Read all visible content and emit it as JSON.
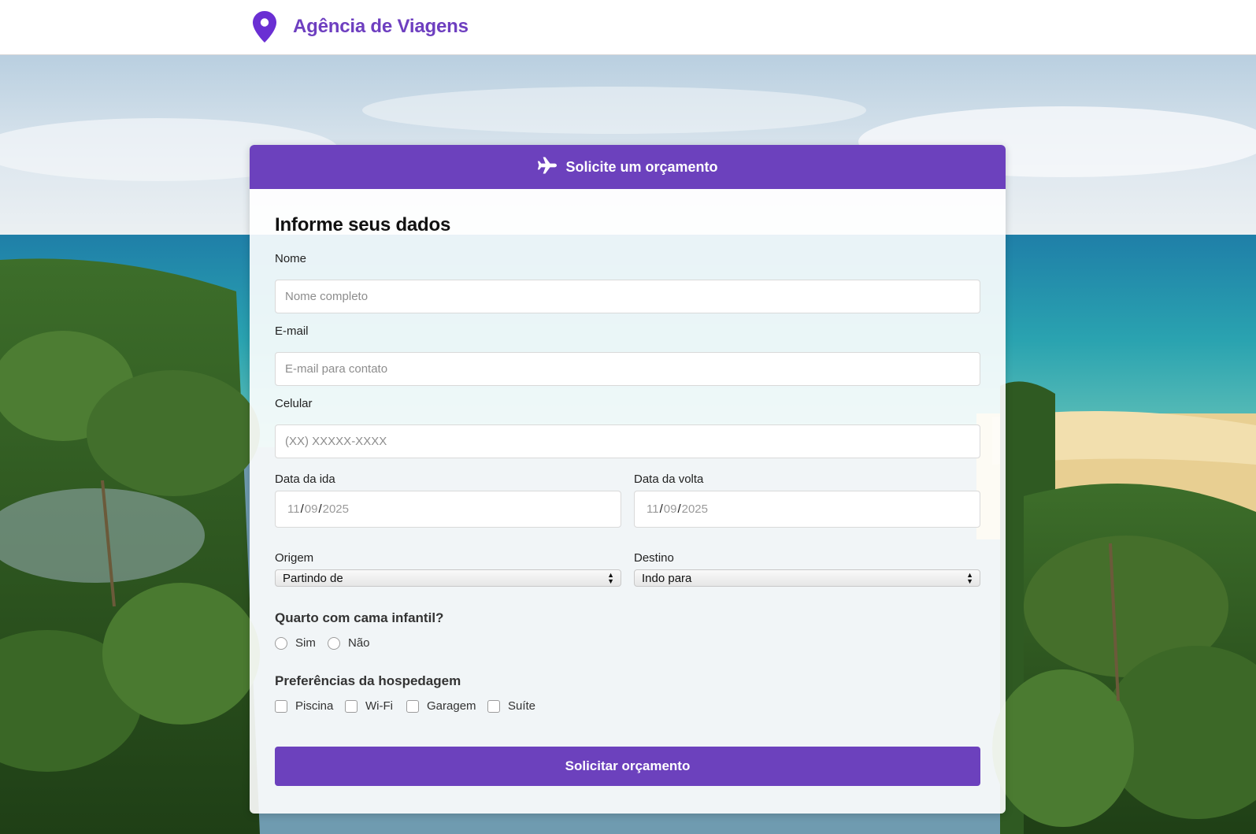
{
  "header": {
    "brand_name": "Agência de Viagens",
    "brand_icon": "map-pin-icon",
    "brand_color": "#6e3fc0"
  },
  "card": {
    "header_icon": "airplane-icon",
    "header_title": "Solicite um orçamento",
    "accent_color": "#6c41bd"
  },
  "form": {
    "title": "Informe seus dados",
    "nome": {
      "label": "Nome",
      "placeholder": "Nome completo",
      "value": ""
    },
    "email": {
      "label": "E-mail",
      "placeholder": "E-mail para contato",
      "value": ""
    },
    "celular": {
      "label": "Celular",
      "placeholder": "(XX) XXXXX-XXXX",
      "value": ""
    },
    "data_ida": {
      "label": "Data da ida",
      "day": "11",
      "month": "09",
      "year": "2025",
      "sep": "/"
    },
    "data_volta": {
      "label": "Data da volta",
      "day": "11",
      "month": "09",
      "year": "2025",
      "sep": "/"
    },
    "origem": {
      "label": "Origem",
      "selected": "Partindo de"
    },
    "destino": {
      "label": "Destino",
      "selected": "Indo para"
    },
    "quarto": {
      "question": "Quarto com cama infantil?",
      "options": [
        "Sim",
        "Não"
      ]
    },
    "preferencias": {
      "title": "Preferências da hospedagem",
      "options": [
        "Piscina",
        "Wi-Fi",
        "Garagem",
        "Suíte"
      ]
    },
    "submit_label": "Solicitar orçamento"
  }
}
